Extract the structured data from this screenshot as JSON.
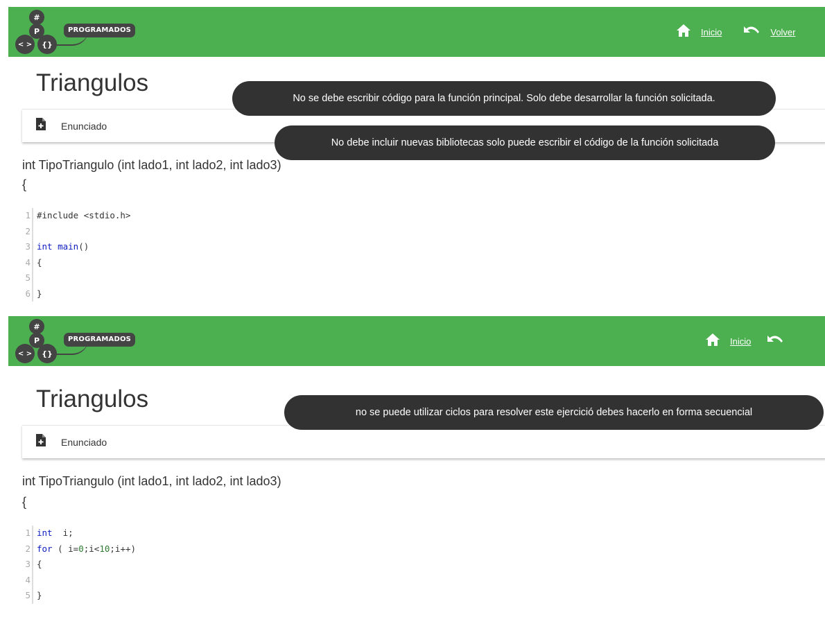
{
  "colors": {
    "navbar": "#4caf50",
    "toast": "#323232",
    "keyword": "#1020c0"
  },
  "screens": [
    {
      "brand": {
        "top_symbol": "#",
        "letter": "P",
        "left_symbol": "< >",
        "right_symbol": "{}",
        "name": "PROGRAMADOS"
      },
      "nav": {
        "home_label": "Inicio",
        "back_label": "Volver"
      },
      "title": "Triangulos",
      "card_label": "Enunciado",
      "toasts": [
        "No se debe escribir código para la función principal. Solo debe desarrollar la función solicitada.",
        "No debe incluir nuevas bibliotecas solo puede escribir el código de la función solicitada"
      ],
      "signature": "int TipoTriangulo (int lado1, int lado2, int lado3)",
      "brace": "{",
      "code_lines": [
        {
          "num": "1",
          "text": "#include <stdio.h>"
        },
        {
          "num": "2",
          "text": ""
        },
        {
          "num": "3",
          "kw": "int",
          "fn": "main",
          "rest": "()"
        },
        {
          "num": "4",
          "text": "{"
        },
        {
          "num": "5",
          "text": ""
        },
        {
          "num": "6",
          "text": "}"
        }
      ]
    },
    {
      "brand": {
        "top_symbol": "#",
        "letter": "P",
        "left_symbol": "< >",
        "right_symbol": "{}",
        "name": "PROGRAMADOS"
      },
      "nav": {
        "home_label": "Inicio"
      },
      "title": "Triangulos",
      "card_label": "Enunciado",
      "toasts": [
        "no se puede utilizar ciclos para resolver este ejercició debes hacerlo en forma secuencial"
      ],
      "signature": "int TipoTriangulo (int lado1, int lado2, int lado3)",
      "brace": "{",
      "code_lines": [
        {
          "num": "1",
          "kw": "int",
          "rest": "  i;"
        },
        {
          "num": "2",
          "kw": "for",
          "rest1": " ( i=",
          "n1": "0",
          "rest2": ";i<",
          "n2": "10",
          "rest3": ";i++)"
        },
        {
          "num": "3",
          "text": "{"
        },
        {
          "num": "4",
          "text": ""
        },
        {
          "num": "5",
          "text": "}"
        }
      ]
    }
  ]
}
